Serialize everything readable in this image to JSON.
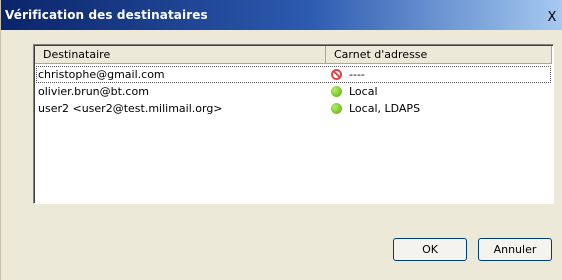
{
  "window": {
    "title": "Vérification des destinataires",
    "close_label": "X"
  },
  "table": {
    "headers": [
      "Destinataire",
      "Carnet d'adresse"
    ],
    "rows": [
      {
        "recipient": "christophe@gmail.com",
        "address_book": "----",
        "status": "not-found"
      },
      {
        "recipient": "olivier.brun@bt.com",
        "address_book": "Local",
        "status": "found"
      },
      {
        "recipient": "user2 <user2@test.milimail.org>",
        "address_book": "Local, LDAPS",
        "status": "found"
      }
    ]
  },
  "buttons": {
    "ok": "OK",
    "cancel": "Annuler"
  },
  "colors": {
    "found": "#5aa81a",
    "not_found": "#e0454a",
    "titlebar": "#0a246a"
  },
  "icons": {
    "found": "green-dot-icon",
    "not_found": "no-entry-icon"
  }
}
